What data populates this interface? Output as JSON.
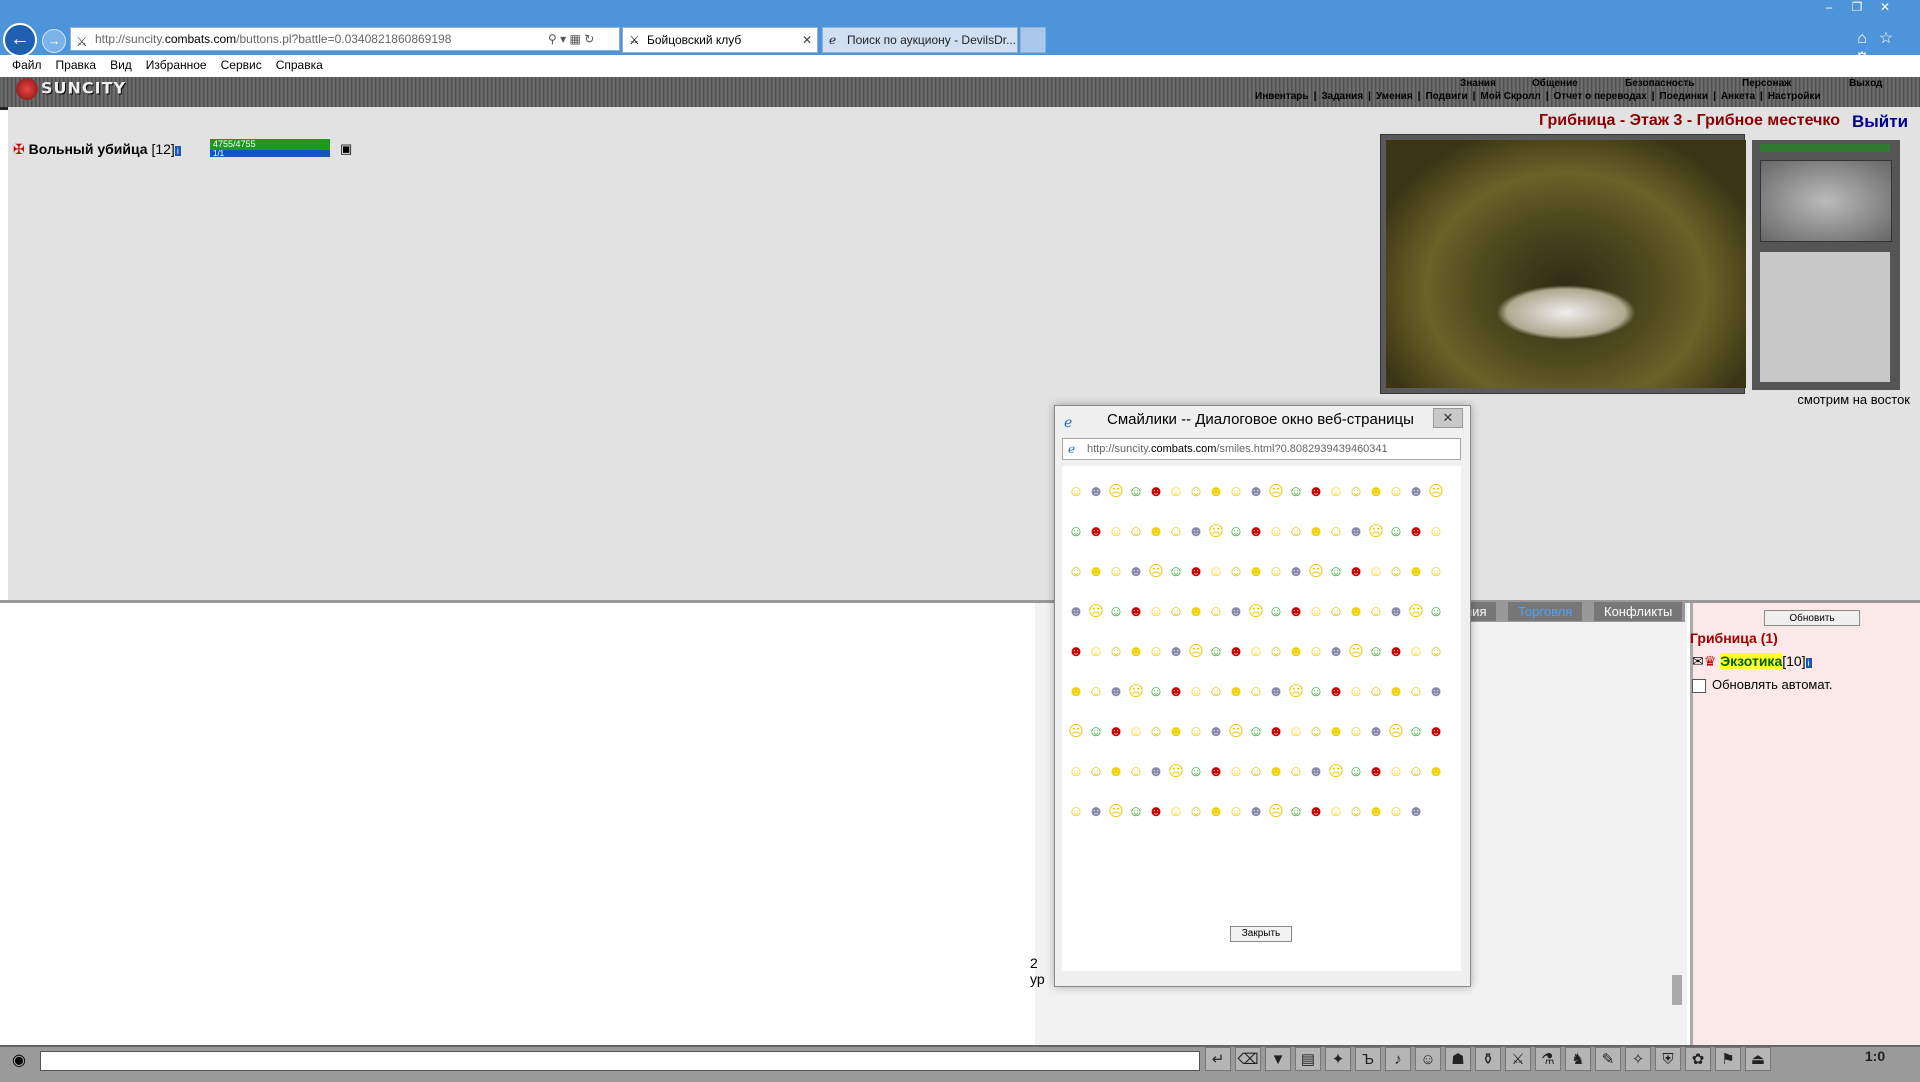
{
  "browser": {
    "url_prefix": "http://suncity.",
    "url_domain": "combats.com",
    "url_path": "/buttons.pl?battle=0.0340821860869198",
    "tabs": [
      {
        "label": "Бойцовский клуб"
      },
      {
        "label": "Поиск по аукциону - DevilsDr..."
      }
    ],
    "menu": [
      "Файл",
      "Правка",
      "Вид",
      "Избранное",
      "Сервис",
      "Справка"
    ]
  },
  "game": {
    "logo": "SUNCITY",
    "top_menu": [
      "Знания",
      "Общение",
      "Безопасность",
      "Персонаж",
      "Выход"
    ],
    "sub_menu": [
      "Инвентарь",
      "|",
      "Задания",
      "|",
      "Умения",
      "|",
      "Подвиги",
      "|",
      "Мой Скролл",
      "|",
      "Отчет о переводах",
      "|",
      "Поединки",
      "|",
      "Анкета",
      "|",
      "Настройки"
    ],
    "location": "Грибница - Этаж 3 - Грибное местечко",
    "exit_label": "Выйти",
    "player": {
      "name": "Вольный убийца",
      "level": "[12]",
      "hp": "4755/4755",
      "mp": "1/1"
    },
    "facing": "смотрим на восток"
  },
  "chat": {
    "tabs": [
      "ния",
      "Торговля",
      "Конфликты"
    ],
    "refresh_label": "Обновить",
    "room_title": "Грибница (1)",
    "user_nick": "Экзотика",
    "user_level": "[10]",
    "auto_update_label": "Обновлять автомат.",
    "fragment": "2 ур"
  },
  "dialog": {
    "title": "Смайлики -- Диалоговое окно веб-страницы",
    "url_prefix": "http://suncity.",
    "url_domain": "combats.com",
    "url_path": "/smiles.html?0.8082939439460341",
    "close_label": "Закрыть"
  },
  "clock": "1:0",
  "colors": {
    "location": "#8c0000",
    "exit": "#00008c",
    "hp": "#1e9a1e",
    "mp": "#1656b8",
    "room_title": "#a00000"
  }
}
